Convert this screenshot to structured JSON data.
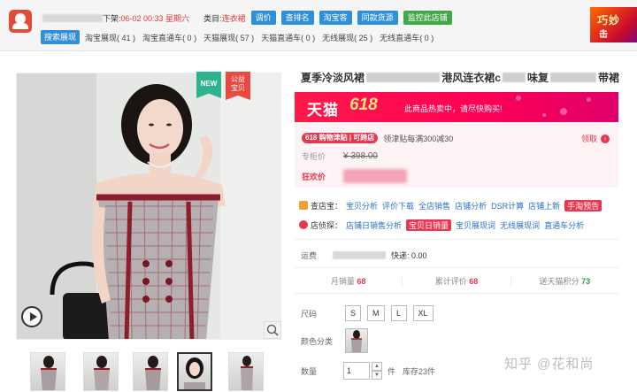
{
  "toolbar": {
    "shelf_label_suffix": "下架:",
    "shelf_time": "06-02 00:33 星期六",
    "category_label": "类目:",
    "category_value": "连衣裙",
    "buttons": [
      "调价",
      "查排名",
      "淘宝客",
      "同款货源",
      "监控此店铺"
    ],
    "search_button": "搜索展现",
    "stats": [
      {
        "label": "淘宝展现",
        "value": "( 41 )"
      },
      {
        "label": "淘宝直通车",
        "value": "( 0 )"
      },
      {
        "label": "天猫展现",
        "value": "( 57 )"
      },
      {
        "label": "天猫直通车",
        "value": "( 0 )"
      },
      {
        "label": "无线展现",
        "value": "( 25 )"
      },
      {
        "label": "无线直通车",
        "value": "( 0 )"
      }
    ],
    "banner_line1": "巧妙",
    "banner_line2": "击"
  },
  "gallery": {
    "badge_new": "NEW",
    "badge_public_line1": "公益",
    "badge_public_line2": "宝贝",
    "zoom_icon": "magnifier-icon",
    "play_icon": "play-icon",
    "thumb_count": 5,
    "active_thumb": 4
  },
  "product": {
    "title_part1": "夏季冷淡风裙",
    "title_part2": "港风连衣裙c",
    "title_part3": "味复",
    "title_part4": "带裙",
    "tmall_logo": "天猫",
    "tmall_618": "618",
    "tmall_sub": "此商品热卖中，请尽快购买!",
    "coupon_tag": "618 购物津贴 | 可跨店",
    "coupon_text": "领津贴每满300减30",
    "claim": "领取",
    "label_list_price": "专柜价",
    "list_price": "¥ 398.00",
    "label_promo": "狂欢价",
    "store_tools_label": "查店宝：",
    "store_tools": [
      "宝贝分析",
      "评价下载",
      "全店销售",
      "店铺分析",
      "DSR计算",
      "店铺上新"
    ],
    "store_tools_hot": "手淘预告",
    "shop_tools_label": "店侦探：",
    "shop_tools_first": "店铺日销售分析",
    "shop_tools_highlight": "宝贝日销量",
    "shop_tools": [
      "宝贝展现词",
      "无线展现词",
      "直通车分析"
    ],
    "freight_label": "运费",
    "freight_value": "快递: 0.00",
    "monthly_label": "月销量",
    "monthly_value": "68",
    "reviews_label": "累计评价",
    "reviews_value": "68",
    "points_label": "送天猫积分",
    "points_value": "73",
    "size_label": "尺码",
    "sizes": [
      "S",
      "M",
      "L",
      "XL"
    ],
    "color_label": "颜色分类",
    "qty_label": "数量",
    "qty_value": "1",
    "qty_unit": "件",
    "stock": "库存23件"
  },
  "watermark": "知乎 @花和尚",
  "colors": {
    "accent_blue": "#2f8fd8",
    "tmall_red": "#ff0055",
    "price_red": "#e8384f",
    "green": "#41a849"
  }
}
